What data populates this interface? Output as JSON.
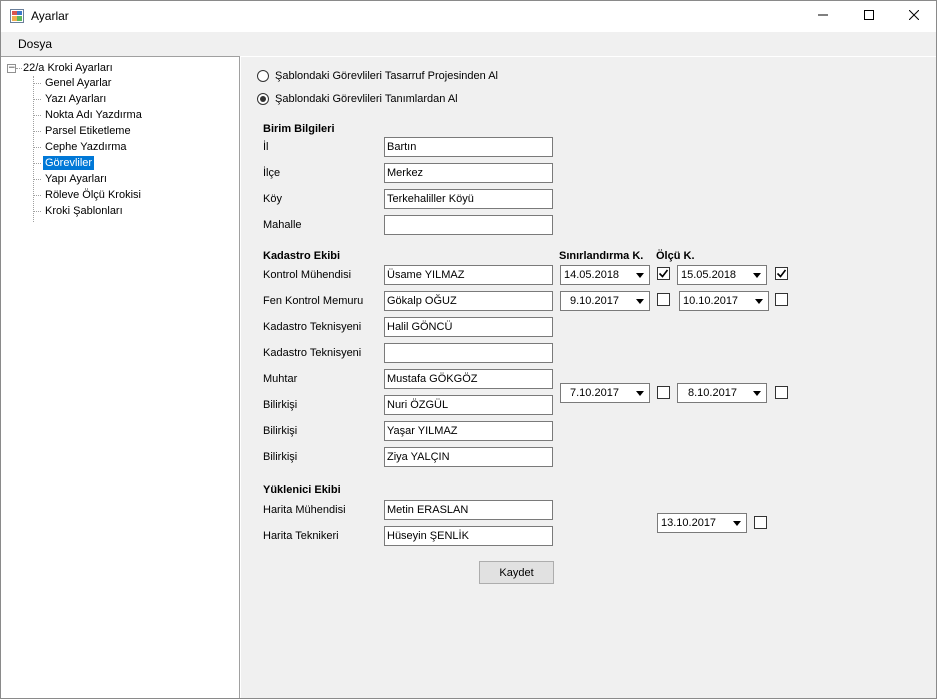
{
  "window": {
    "title": "Ayarlar"
  },
  "menu": {
    "file": "Dosya"
  },
  "tree": {
    "root": "22/a Kroki Ayarları",
    "items": [
      "Genel Ayarlar",
      "Yazı Ayarları",
      "Nokta Adı Yazdırma",
      "Parsel Etiketleme",
      "Cephe Yazdırma",
      "Görevliler",
      "Yapı Ayarları",
      "Röleve Ölçü Krokisi",
      "Kroki Şablonları"
    ],
    "selected": "Görevliler"
  },
  "options": {
    "radio1": {
      "label": "Şablondaki Görevlileri Tasarruf Projesinden Al",
      "checked": false
    },
    "radio2": {
      "label": "Şablondaki Görevlileri Tanımlardan Al",
      "checked": true
    }
  },
  "unit": {
    "heading": "Birim Bilgileri",
    "il_label": "İl",
    "il_value": "Bartın",
    "ilce_label": "İlçe",
    "ilce_value": "Merkez",
    "koy_label": "Köy",
    "koy_value": "Terkehaliller Köyü",
    "mahalle_label": "Mahalle",
    "mahalle_value": ""
  },
  "cadastre": {
    "heading": "Kadastro Ekibi",
    "col_limit": "Sınırlandırma K.",
    "col_measure": "Ölçü K.",
    "kontrol_label": "Kontrol Mühendisi",
    "kontrol_value": "Üsame YILMAZ",
    "fen_label": "Fen Kontrol Memuru",
    "fen_value": "Gökalp OĞUZ",
    "tek1_label": "Kadastro Teknisyeni",
    "tek1_value": "Halil GÖNCÜ",
    "tek2_label": "Kadastro Teknisyeni",
    "tek2_value": "",
    "muhtar_label": "Muhtar",
    "muhtar_value": "Mustafa GÖKGÖZ",
    "bil1_label": "Bilirkişi",
    "bil1_value": "Nuri ÖZGÜL",
    "bil2_label": "Bilirkişi",
    "bil2_value": "Yaşar YILMAZ",
    "bil3_label": "Bilirkişi",
    "bil3_value": "Ziya YALÇIN",
    "dates": {
      "kontrol_limit": "14.05.2018",
      "kontrol_limit_checked": true,
      "kontrol_measure": "15.05.2018",
      "kontrol_measure_checked": true,
      "fen_limit": "9.10.2017",
      "fen_limit_checked": false,
      "fen_measure": "10.10.2017",
      "fen_measure_checked": false,
      "muhtar_limit": "7.10.2017",
      "muhtar_limit_checked": false,
      "muhtar_measure": "8.10.2017",
      "muhtar_measure_checked": false
    }
  },
  "contractor": {
    "heading": "Yüklenici Ekibi",
    "muh_label": "Harita Mühendisi",
    "muh_value": "Metin ERASLAN",
    "tek_label": "Harita Teknikeri",
    "tek_value": "Hüseyin ŞENLİK",
    "date": "13.10.2017",
    "date_checked": false
  },
  "actions": {
    "save": "Kaydet"
  }
}
